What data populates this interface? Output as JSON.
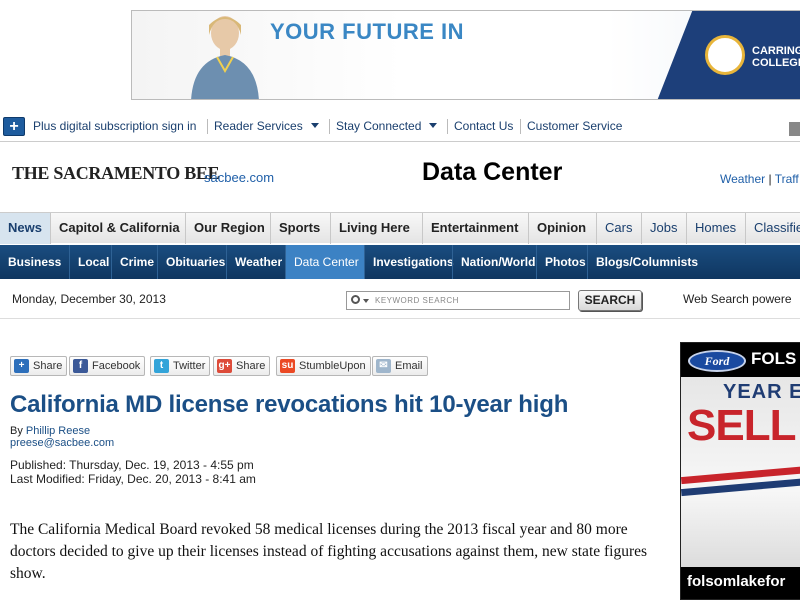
{
  "top_ad": {
    "headline": "YOUR FUTURE IN",
    "brand_line1": "CARRING",
    "brand_line2": "COLLEGE"
  },
  "utility_bar": {
    "subscription_link": "Plus digital subscription sign in",
    "reader_services": "Reader Services",
    "stay_connected": "Stay Connected",
    "contact_us": "Contact Us",
    "customer_service": "Customer Service"
  },
  "masthead": {
    "logo": "THE SACRAMENTO BEE",
    "site_link": "sacbee.com",
    "section_title": "Data Center",
    "weather": "Weather",
    "separator": "|",
    "traffic": "Traff"
  },
  "primary_nav": [
    "News",
    "Capitol & California",
    "Our Region",
    "Sports",
    "Living Here",
    "Entertainment",
    "Opinion",
    "Cars",
    "Jobs",
    "Homes",
    "Classifie"
  ],
  "secondary_nav": [
    "Business",
    "Local",
    "Crime",
    "Obituaries",
    "Weather",
    "Data Center",
    "Investigations",
    "Nation/World",
    "Photos",
    "Blogs/Columnists"
  ],
  "date_bar": {
    "date": "Monday, December 30, 2013",
    "search_placeholder": "KEYWORD SEARCH",
    "search_button": "SEARCH",
    "web_search": "Web Search powere"
  },
  "share_bar": {
    "share": "Share",
    "facebook": "Facebook",
    "twitter": "Twitter",
    "gplus": "Share",
    "stumbleupon": "StumbleUpon",
    "email": "Email"
  },
  "article": {
    "headline": "California MD license revocations hit 10-year high",
    "by": "By",
    "author": "Phillip Reese",
    "email": "preese@sacbee.com",
    "published": "Published: Thursday, Dec. 19, 2013 - 4:55 pm",
    "modified": "Last Modified: Friday, Dec. 20, 2013 - 8:41 am",
    "body": "The California Medical Board revoked 58 medical licenses during the 2013 fiscal year and 80 more doctors decided to give up their licenses instead of fighting accusations against them, new state figures show."
  },
  "side_ad": {
    "ford": "Ford",
    "title": "FOLS",
    "year": "YEAR E",
    "sell": "SELL",
    "url": "folsomlakefor"
  },
  "colors": {
    "nav_blue": "#0f3660",
    "active_tab": "#3c82c4",
    "headline_blue": "#1b4f86",
    "link_blue": "#1f5fa8"
  }
}
